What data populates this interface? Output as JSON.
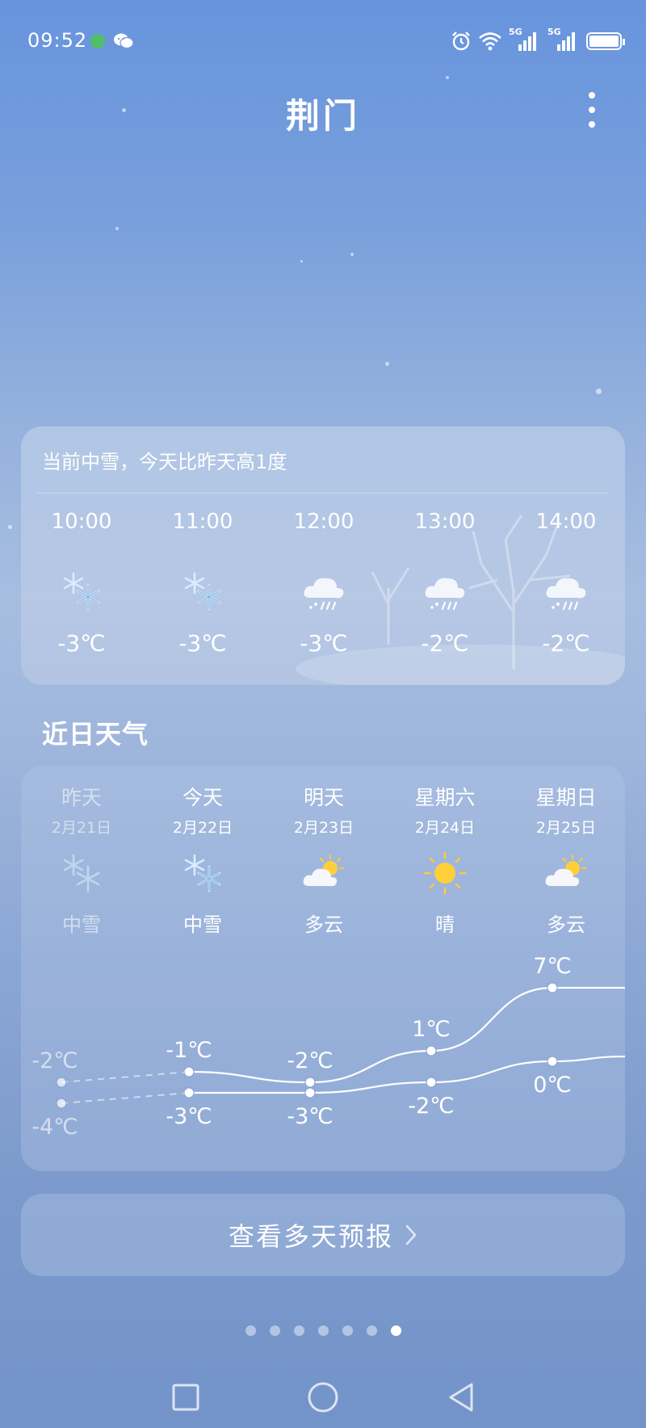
{
  "status_bar": {
    "time": "09:52",
    "notification_icons": [
      "green-dot-icon",
      "wechat-icon"
    ],
    "right_icons": [
      "alarm-icon",
      "wifi-icon",
      "signal-5g-icon",
      "signal-5g-icon",
      "battery-icon"
    ],
    "network_label_1": "5G",
    "network_label_2": "5G"
  },
  "header": {
    "city": "荆门",
    "menu_icon": "more-vertical-icon"
  },
  "hourly": {
    "summary": "当前中雪，今天比昨天高1度",
    "items": [
      {
        "time": "10:00",
        "icon": "snowflake-icon",
        "temp": "-3℃"
      },
      {
        "time": "11:00",
        "icon": "snowflake-icon",
        "temp": "-3℃"
      },
      {
        "time": "12:00",
        "icon": "snow-cloud-icon",
        "temp": "-3℃"
      },
      {
        "time": "13:00",
        "icon": "snow-cloud-icon",
        "temp": "-2℃"
      },
      {
        "time": "14:00",
        "icon": "snow-cloud-icon",
        "temp": "-2℃"
      }
    ]
  },
  "recent": {
    "title": "近日天气",
    "days": [
      {
        "name": "昨天",
        "date": "2月21日",
        "icon": "snowflake-icon",
        "condition": "中雪",
        "high": "-2℃",
        "low": "-4℃",
        "high_value": -2,
        "low_value": -4,
        "past": true
      },
      {
        "name": "今天",
        "date": "2月22日",
        "icon": "snowflake-icon",
        "condition": "中雪",
        "high": "-1℃",
        "low": "-3℃",
        "high_value": -1,
        "low_value": -3,
        "past": false
      },
      {
        "name": "明天",
        "date": "2月23日",
        "icon": "partly-cloudy-icon",
        "condition": "多云",
        "high": "-2℃",
        "low": "-3℃",
        "high_value": -2,
        "low_value": -3,
        "past": false
      },
      {
        "name": "星期六",
        "date": "2月24日",
        "icon": "sun-icon",
        "condition": "晴",
        "high": "1℃",
        "low": "-2℃",
        "high_value": 1,
        "low_value": -2,
        "past": false
      },
      {
        "name": "星期日",
        "date": "2月25日",
        "icon": "partly-cloudy-icon",
        "condition": "多云",
        "high": "7℃",
        "low": "0℃",
        "high_value": 7,
        "low_value": 0,
        "past": false
      }
    ]
  },
  "forecast_button": {
    "label": "查看多天预报"
  },
  "page_indicator": {
    "count": 7,
    "active_index": 6
  },
  "nav_bar": {
    "buttons": [
      "recents-square-icon",
      "home-circle-icon",
      "back-triangle-icon"
    ]
  }
}
